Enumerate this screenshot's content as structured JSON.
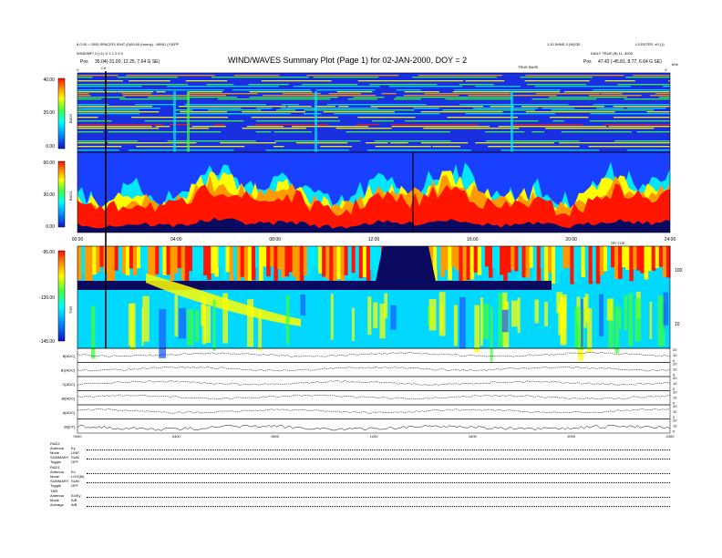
{
  "header": {
    "title": "WIND/WAVES Summary Plot (Page 1) for 02-JAN-2000, DOY = 2",
    "left_line1": "6.0 00 > 2000 SPACEFLIGHT (0)00:00 (hourly) - WIND (Y)EPF",
    "left_line2": "WIND/MFI 3 (=1) D 1 1 0 0 0",
    "left_pos_label": "Pos",
    "left_pos_value": "35.04(-31.00, 12.25, 7.64 G SE)",
    "right_line1": "1.10 WIND 3 (W)OD",
    "right_line1b": "L3 ENTER, s9 (1)",
    "right_line2": "DAILY TRUE (B) 11, 3000",
    "right_pos_label": "Pos",
    "right_pos_value": "47.42 (-45.81, 8.77, 6.64 G SE)",
    "center_small": "TRUE BASE",
    "marker_label": "Cd",
    "tick_v_left": "V",
    "tick_v_right": "V",
    "unit_right": "kHz"
  },
  "chart_data": [
    {
      "type": "heatmap",
      "name": "RAD2",
      "ylabel": "RAD2",
      "colorbar_ticks": [
        "40.00",
        "20.00",
        "0.00"
      ],
      "colorbar_range": [
        0,
        40
      ]
    },
    {
      "type": "heatmap",
      "name": "RAD1",
      "ylabel": "RAD1",
      "colorbar_ticks": [
        "60.00",
        "30.00",
        "0.00"
      ],
      "colorbar_range": [
        0,
        60
      ],
      "x_ticks": [
        "00:00",
        "04:00",
        "08:00",
        "12:00",
        "16:00",
        "20:00",
        "24:00"
      ],
      "x_label_right": "OR YOE"
    },
    {
      "type": "heatmap",
      "name": "TNR",
      "ylabel": "TNR",
      "colorbar_ticks": [
        "-95.00",
        "-120.00",
        "-145.00"
      ],
      "colorbar_range": [
        -145,
        -95
      ],
      "right_ticks": [
        "100",
        "10"
      ]
    },
    {
      "type": "line",
      "name": "stack",
      "panels": [
        {
          "label": "B[ADC]",
          "right": [
            "20",
            "10",
            "0"
          ]
        },
        {
          "label": "Bz[ADC]",
          "right": [
            "20",
            "10",
            "0"
          ]
        },
        {
          "label": "C[ADC]",
          "right": [
            "20",
            "10",
            "0"
          ]
        },
        {
          "label": "Bt[ADC]",
          "right": [
            "20",
            "10",
            "0"
          ]
        },
        {
          "label": "A[ADC]",
          "right": [
            "20",
            "10",
            "0"
          ]
        },
        {
          "label": "|B|[nT]",
          "right": [
            "20",
            "10",
            "0"
          ]
        }
      ],
      "x_ticks": [
        "0000",
        "0400",
        "0800",
        "1200",
        "1600",
        "2000",
        "2400"
      ]
    }
  ],
  "legend_block": {
    "rad2_title": "RAD2",
    "rad2_rows": [
      {
        "k": "Antenna",
        "v": "Ey"
      },
      {
        "k": "Mode",
        "v": "LINE"
      },
      {
        "k": "SUMMARY",
        "v": "SUM"
      },
      {
        "k": "Toggle",
        "v": "OFF"
      }
    ],
    "rad1_title": "RAD1",
    "rad1_rows": [
      {
        "k": "Antenna",
        "v": "Ex"
      },
      {
        "k": "Mode",
        "v": "LOG(M)"
      },
      {
        "k": "SUMMARY",
        "v": "SUM"
      },
      {
        "k": "Toggle",
        "v": "OFF"
      }
    ],
    "tnr_title": "TNR",
    "tnr_rows": [
      {
        "k": "Antenna",
        "v": "Ex/Ey"
      },
      {
        "k": "Mode",
        "v": "A/B"
      },
      {
        "k": "Average",
        "v": "A/B"
      }
    ]
  },
  "colors": {
    "red": "#ff1500",
    "orange": "#ff9a00",
    "yellow": "#ffff00",
    "green": "#3cff3c",
    "cyan": "#00e6ff",
    "blue": "#0040ff",
    "navy": "#0a0a60"
  }
}
